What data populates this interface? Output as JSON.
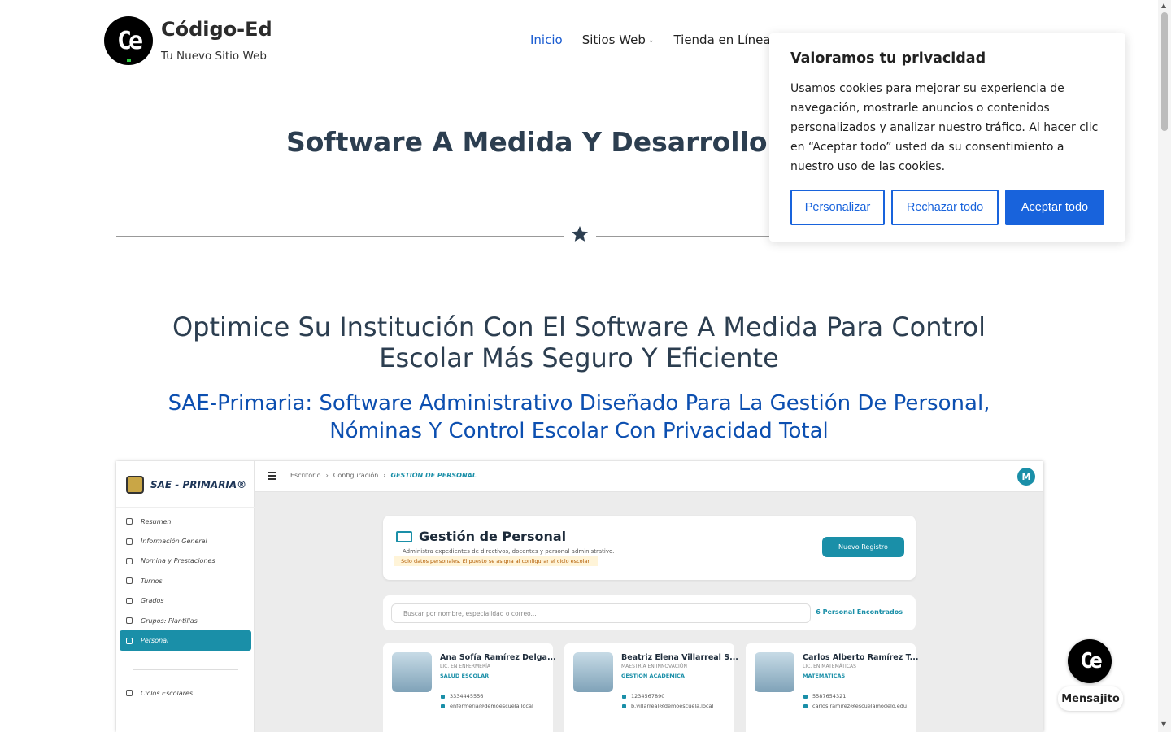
{
  "site": {
    "title": "Código-Ed",
    "tagline": "Tu Nuevo Sitio Web",
    "logo_mark": "Ce"
  },
  "nav": {
    "items": [
      {
        "label": "Inicio",
        "active": true
      },
      {
        "label": "Sitios Web",
        "dropdown": true
      },
      {
        "label": "Tienda en Línea"
      }
    ]
  },
  "hero": {
    "title": "Software A Medida Y Desarrollo Web P"
  },
  "section": {
    "title": "Optimice Su Institución Con El Software A Medida Para Control Escolar Más Seguro Y Eficiente",
    "subtitle": "SAE-Primaria: Software Administrativo Diseñado Para La Gestión De Personal, Nóminas Y Control Escolar Con Privacidad Total"
  },
  "app": {
    "brand": "SAE - PRIMARIA®",
    "menu": [
      "Resumen",
      "Información General",
      "Nomina y Prestaciones",
      "Turnos",
      "Grados",
      "Grupos: Plantillas",
      "Personal"
    ],
    "menu_active_index": 6,
    "menu_cycles": "Ciclos Escolares",
    "breadcrumbs": [
      "Escritorio",
      "Configuración",
      "GESTIÓN DE PERSONAL"
    ],
    "avatar_letter": "M",
    "page_title": "Gestión de Personal",
    "page_desc": "Administra expedientes de directivos, docentes y personal administrativo.",
    "page_warning": "Solo datos personales. El puesto se asigna al configurar el ciclo escolar.",
    "new_button": "Nuevo Registro",
    "search_placeholder": "Buscar por nombre, especialidad o correo...",
    "search_count": "6 Personal Encontrados",
    "people": [
      {
        "name": "Ana Sofía Ramírez Delga...",
        "degree": "LIC. EN ENFERMERÍA",
        "area": "SALUD ESCOLAR",
        "phone": "3334445556",
        "email": "enfermeria@demoescuela.local"
      },
      {
        "name": "Beatriz Elena Villarreal S...",
        "degree": "MAESTRÍA EN INNOVACIÓN",
        "area": "GESTIÓN ACADÉMICA",
        "phone": "1234567890",
        "email": "b.villarreal@demoescuela.local"
      },
      {
        "name": "Carlos Alberto Ramírez T...",
        "degree": "LIC. EN MATEMÁTICAS",
        "area": "MATEMÁTICAS",
        "phone": "5587654321",
        "email": "carlos.ramirez@escuelamodelo.edu"
      }
    ]
  },
  "cookie": {
    "title": "Valoramos tu privacidad",
    "text": "Usamos cookies para mejorar su experiencia de navegación, mostrarle anuncios o contenidos personalizados y analizar nuestro tráfico. Al hacer clic en “Aceptar todo” usted da su consentimiento a nuestro uso de las cookies.",
    "customize": "Personalizar",
    "reject": "Rechazar todo",
    "accept": "Aceptar todo"
  },
  "chat": {
    "label": "Mensajito"
  },
  "colors": {
    "accent": "#1863dc",
    "heading": "#2c3e50",
    "subtitle": "#0c4fb0",
    "app_teal": "#1a8fa8"
  }
}
